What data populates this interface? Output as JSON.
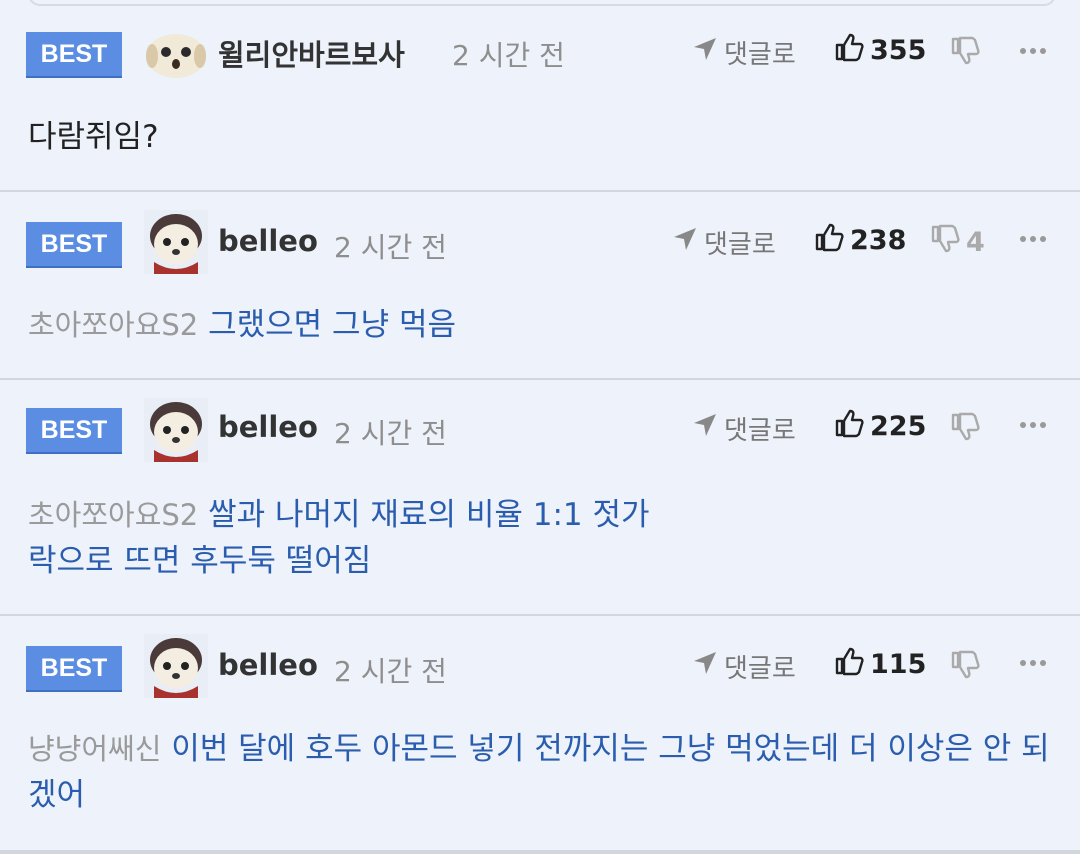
{
  "comments": [
    {
      "badge": "BEST",
      "nickname": "윌리안바르보사",
      "time": "2 시간 전",
      "reply_label": "댓글로",
      "likes": "355",
      "dislikes": "",
      "mention": "",
      "text": "다람쥐임?",
      "avatar_icon": "puppy-avatar-icon"
    },
    {
      "badge": "BEST",
      "nickname": "belleo",
      "time": "2 시간 전",
      "reply_label": "댓글로",
      "likes": "238",
      "dislikes": "4",
      "mention": "초아쪼아요S2",
      "text": "그랬으면 그냥 먹음",
      "avatar_icon": "dog-avatar-icon"
    },
    {
      "badge": "BEST",
      "nickname": "belleo",
      "time": "2 시간 전",
      "reply_label": "댓글로",
      "likes": "225",
      "dislikes": "",
      "mention": "초아쪼아요S2",
      "text": "쌀과 나머지 재료의 비율 1:1 젓가락으로 뜨면 후두둑 떨어짐",
      "avatar_icon": "dog-avatar-icon"
    },
    {
      "badge": "BEST",
      "nickname": "belleo",
      "time": "2 시간 전",
      "reply_label": "댓글로",
      "likes": "115",
      "dislikes": "",
      "mention": "냥냥어쌔신",
      "text": "이번 달에 호두 아몬드 넣기 전까지는 그냥 먹었는데 더 이상은 안 되겠어",
      "avatar_icon": "dog-avatar-icon"
    }
  ],
  "colors": {
    "background": "#eef2fb",
    "badge": "#5b8de2",
    "quote_text": "#2a5dad",
    "mention_text": "#9a9a9a"
  }
}
